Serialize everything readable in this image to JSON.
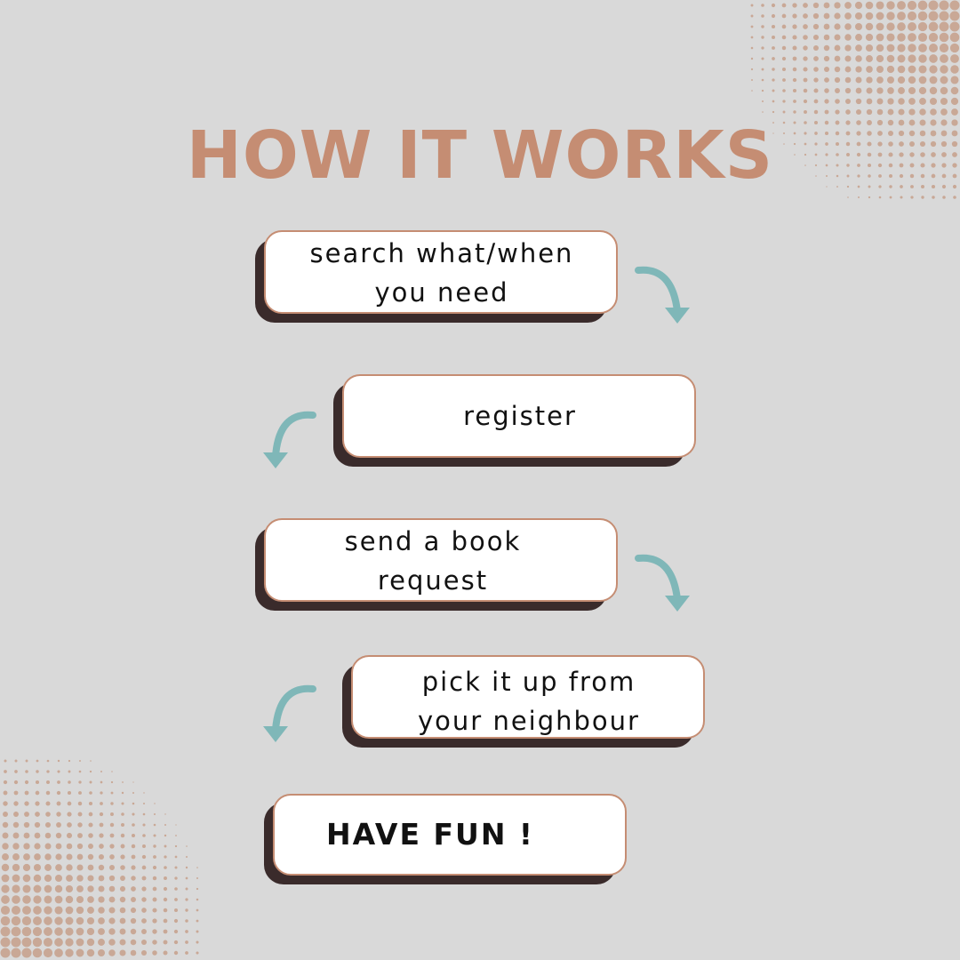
{
  "title": "HOW IT WORKS",
  "colors": {
    "background": "#d9d9d9",
    "accent": "#c58d73",
    "card": "#ffffff",
    "shadow": "#3a2b2b",
    "arrow": "#7fb7b8",
    "dots": "#c9a896"
  },
  "steps": [
    {
      "label": "search what/when you need"
    },
    {
      "label": "register"
    },
    {
      "label": "send a book request"
    },
    {
      "label": "pick it up from your neighbour"
    },
    {
      "label": "HAVE FUN !"
    }
  ],
  "arrows": [
    {
      "icon": "curved-arrow-down-right-icon"
    },
    {
      "icon": "curved-arrow-down-left-icon"
    },
    {
      "icon": "curved-arrow-down-right-icon"
    },
    {
      "icon": "curved-arrow-down-left-icon"
    }
  ]
}
